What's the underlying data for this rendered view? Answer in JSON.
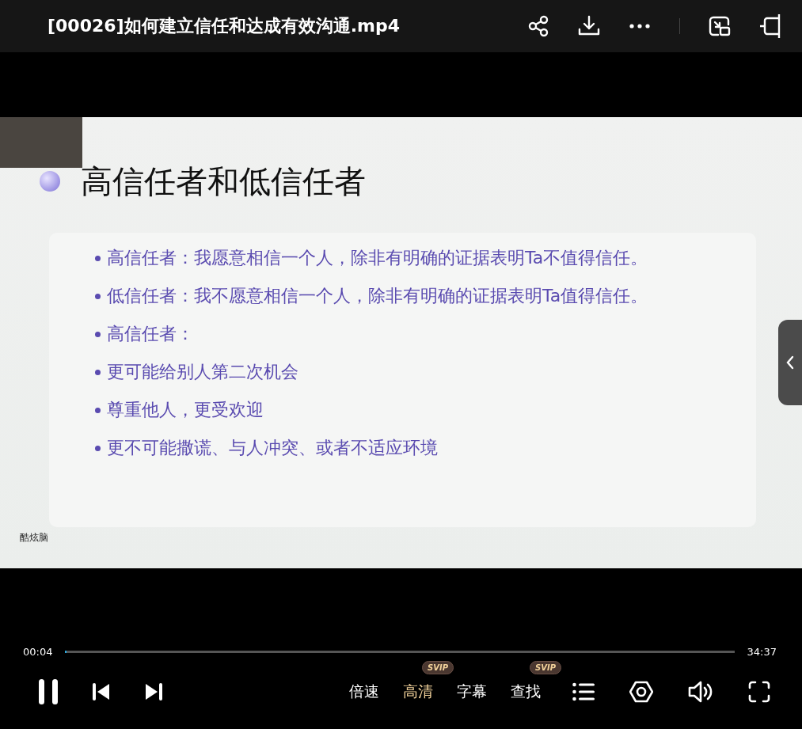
{
  "window": {
    "title": "[00026]如何建立信任和达成有效沟通.mp4"
  },
  "video": {
    "slide": {
      "title": "高信任者和低信任者",
      "bullets": [
        "高信任者：我愿意相信一个人，除非有明确的证据表明Ta不值得信任。",
        "低信任者：我不愿意相信一个人，除非有明确的证据表明Ta值得信任。",
        "高信任者：",
        "更可能给别人第二次机会",
        "尊重他人，更受欢迎",
        "更不可能撒谎、与人冲突、或者不适应环境"
      ],
      "footer": "酷炫脑"
    }
  },
  "progress": {
    "elapsed": "00:04",
    "duration": "34:37",
    "level": 0.002
  },
  "controls": [
    {
      "label": "倍速",
      "selected": false
    },
    {
      "label": "高清",
      "selected": true,
      "badge": "SVIP"
    },
    {
      "label": "字幕",
      "selected": false
    },
    {
      "label": "查找",
      "selected": false,
      "badge": "SVIP"
    }
  ]
}
